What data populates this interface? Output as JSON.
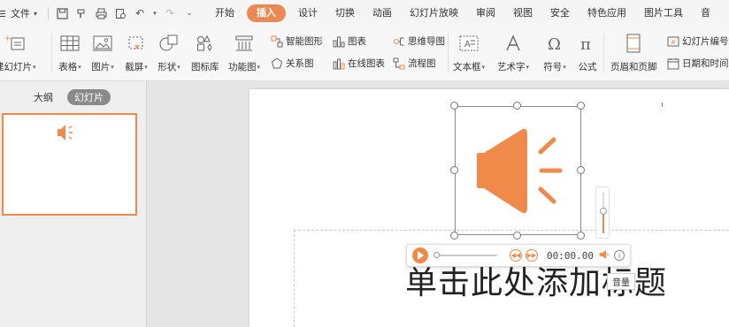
{
  "menubar": {
    "file_label": "文件",
    "tabs": [
      {
        "label": "开始",
        "active": false
      },
      {
        "label": "插入",
        "active": true
      },
      {
        "label": "设计",
        "active": false
      },
      {
        "label": "切换",
        "active": false
      },
      {
        "label": "动画",
        "active": false
      },
      {
        "label": "幻灯片放映",
        "active": false
      },
      {
        "label": "审阅",
        "active": false
      },
      {
        "label": "视图",
        "active": false
      },
      {
        "label": "安全",
        "active": false
      },
      {
        "label": "特色应用",
        "active": false
      },
      {
        "label": "图片工具",
        "active": false
      },
      {
        "label": "音",
        "active": false
      }
    ]
  },
  "ribbon": {
    "new_slide": "建幻灯片",
    "table": "表格",
    "picture": "图片",
    "screenshot": "截屏",
    "shape": "形状",
    "icon_lib": "图标库",
    "func_chart": "功能图",
    "smart_graphic": "智能图形",
    "relation_chart": "关系图",
    "chart": "图表",
    "online_chart": "在线图表",
    "mind_map": "思维导图",
    "flowchart": "流程图",
    "text_box": "文本框",
    "word_art": "艺术字",
    "symbol": "符号",
    "formula": "公式",
    "header_footer": "页眉和页脚",
    "slide_number": "幻灯片编号",
    "date_time": "日期和时间"
  },
  "left_panel": {
    "tab_outline": "大纲",
    "tab_slides": "幻灯片"
  },
  "slide": {
    "title_placeholder": "单击此处添加标题"
  },
  "player": {
    "time": "00:00.00",
    "volume_tooltip": "音量",
    "volume_level": 0.55,
    "progress": 0
  },
  "colors": {
    "accent": "#ea8a52",
    "speaker": "#ef8a4b"
  }
}
